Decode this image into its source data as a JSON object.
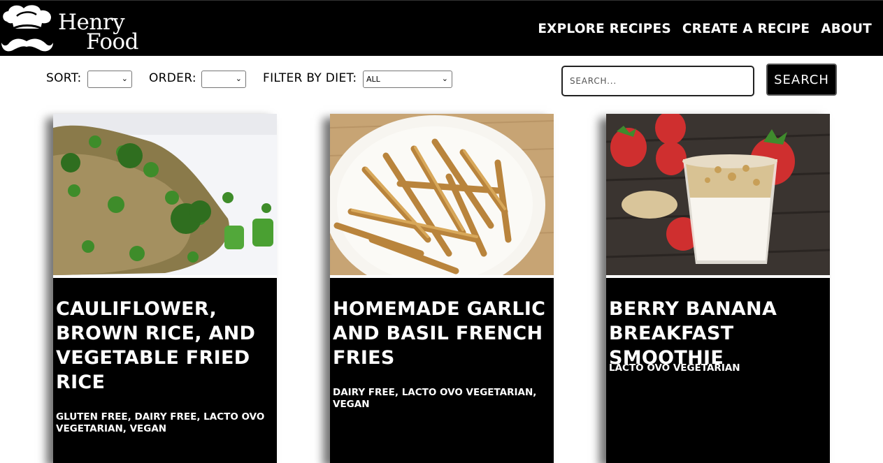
{
  "brand": {
    "line1": "Henry",
    "line2": "Food"
  },
  "nav": {
    "links": [
      "EXPLORE RECIPES",
      "CREATE A RECIPE",
      "ABOUT"
    ]
  },
  "controls": {
    "sort_label": "SORT:",
    "sort_value": "",
    "order_label": "ORDER:",
    "order_value": "",
    "filter_label": "FILTER BY DIET:",
    "filter_value": "ALL",
    "search_placeholder": "SEARCH...",
    "search_button": "SEARCH"
  },
  "recipes": [
    {
      "title": "CAULIFLOWER, BROWN RICE, AND VEGETABLE FRIED RICE",
      "diets": "GLUTEN FREE, DAIRY FREE, LACTO OVO VEGETARIAN, VEGAN"
    },
    {
      "title": "HOMEMADE GARLIC AND BASIL FRENCH FRIES",
      "diets": "DAIRY FREE, LACTO OVO VEGETARIAN, VEGAN"
    },
    {
      "title": "BERRY BANANA BREAKFAST SMOOTHIE",
      "diets": "LACTO OVO VEGETARIAN"
    }
  ],
  "icons": {
    "logo": "chef-hat-mustache-icon",
    "select_caret": "chevron-down-icon"
  },
  "colors": {
    "navbar": "#000000",
    "card": "#000000",
    "text_on_dark": "#ffffff"
  }
}
